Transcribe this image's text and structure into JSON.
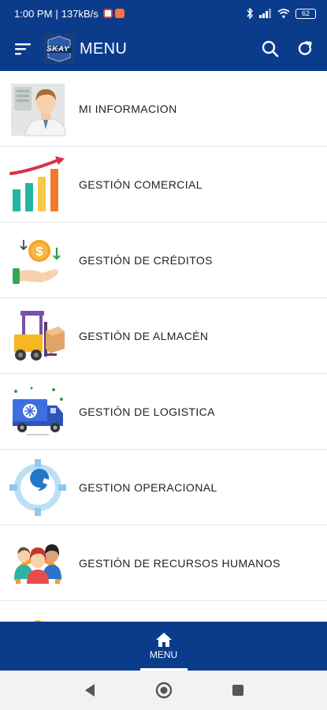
{
  "status_bar": {
    "time": "1:00 PM",
    "speed": "137kB/s",
    "battery": "62"
  },
  "app_bar": {
    "title": "MENU",
    "logo_text": "SKAY"
  },
  "menu": {
    "items": [
      {
        "label": "MI INFORMACION",
        "icon": "profile-icon"
      },
      {
        "label": "GESTIÓN COMERCIAL",
        "icon": "bar-chart-icon"
      },
      {
        "label": "GESTIÓN DE CRÉDITOS",
        "icon": "money-hand-icon"
      },
      {
        "label": "GESTIÓN DE ALMACÉN",
        "icon": "forklift-icon"
      },
      {
        "label": "GESTIÓN DE LOGISTICA",
        "icon": "truck-icon"
      },
      {
        "label": "GESTION OPERACIONAL",
        "icon": "wrench-gear-icon"
      },
      {
        "label": "GESTIÓN DE RECURSOS HUMANOS",
        "icon": "team-icon"
      }
    ]
  },
  "bottom_nav": {
    "items": [
      {
        "label": "MENU",
        "icon": "home-icon",
        "active": true
      }
    ]
  },
  "colors": {
    "primary": "#0b3c8c",
    "divider": "#e6e6e6"
  }
}
